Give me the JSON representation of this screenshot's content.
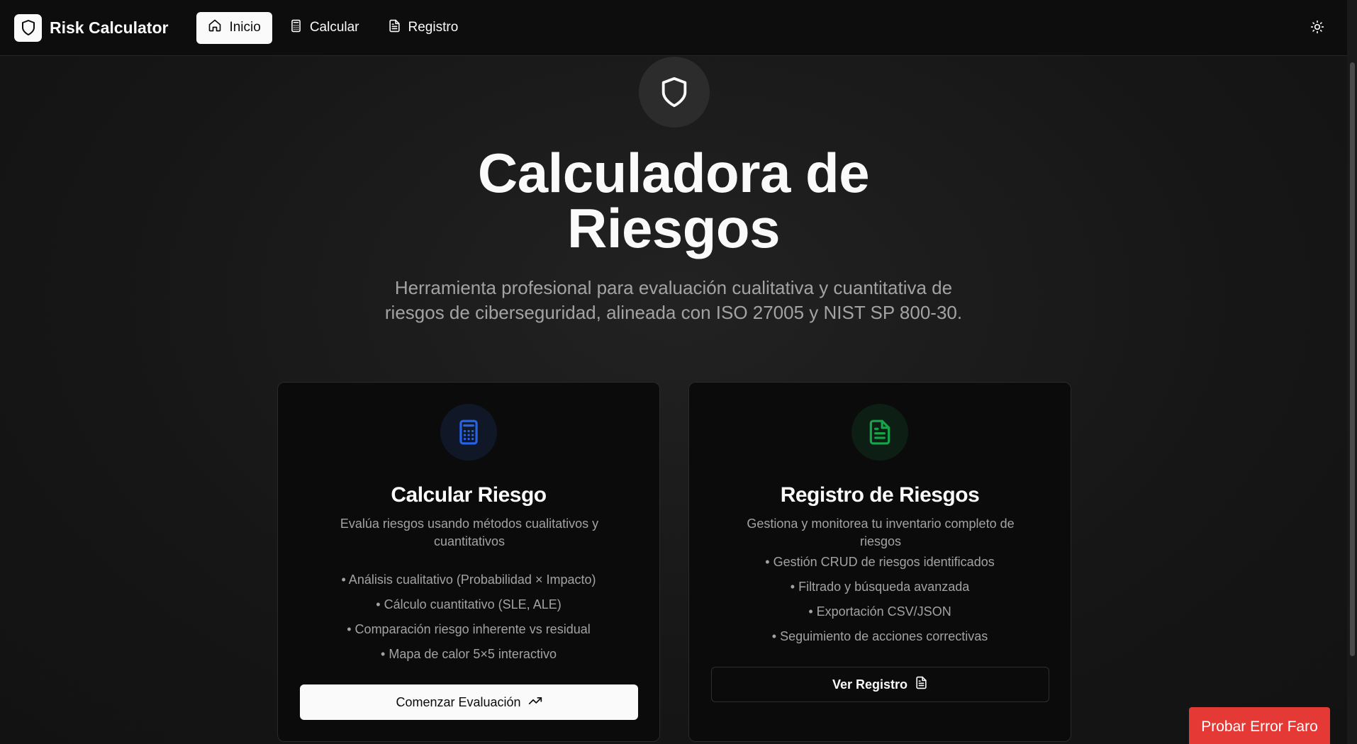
{
  "header": {
    "brand_title": "Risk Calculator",
    "nav": [
      {
        "label": "Inicio",
        "icon": "home-icon",
        "active": true
      },
      {
        "label": "Calcular",
        "icon": "calculator-icon",
        "active": false
      },
      {
        "label": "Registro",
        "icon": "file-text-icon",
        "active": false
      }
    ],
    "theme_toggle_icon": "sun-icon"
  },
  "hero": {
    "icon": "shield-icon",
    "title_line1": "Calculadora de",
    "title_line2": "Riesgos",
    "subtitle_line1": "Herramienta profesional para evaluación cualitativa y cuantitativa de",
    "subtitle_line2": "riesgos de ciberseguridad, alineada con ISO 27005 y NIST SP 800-30."
  },
  "cards": [
    {
      "icon": "calculator-icon",
      "icon_color": "#2563eb",
      "title": "Calcular Riesgo",
      "description": "Evalúa riesgos usando métodos cualitativos y cuantitativos",
      "features": [
        "• Análisis cualitativo (Probabilidad × Impacto)",
        "• Cálculo cuantitativo (SLE, ALE)",
        "• Comparación riesgo inherente vs residual",
        "• Mapa de calor 5×5 interactivo"
      ],
      "button_label": "Comenzar Evaluación",
      "button_icon": "trending-up-icon"
    },
    {
      "icon": "file-text-icon",
      "icon_color": "#16a34a",
      "title": "Registro de Riesgos",
      "description": "Gestiona y monitorea tu inventario completo de riesgos",
      "features": [
        "• Gestión CRUD de riesgos identificados",
        "• Filtrado y búsqueda avanzada",
        "• Exportación CSV/JSON",
        "• Seguimiento de acciones correctivas"
      ],
      "button_label": "Ver Registro",
      "button_icon": "file-text-icon"
    }
  ],
  "error_button_label": "Probar Error Faro",
  "colors": {
    "background": "#161616",
    "topbar": "#0d0d0d",
    "card": "#0b0b0b",
    "error": "#e53935"
  }
}
